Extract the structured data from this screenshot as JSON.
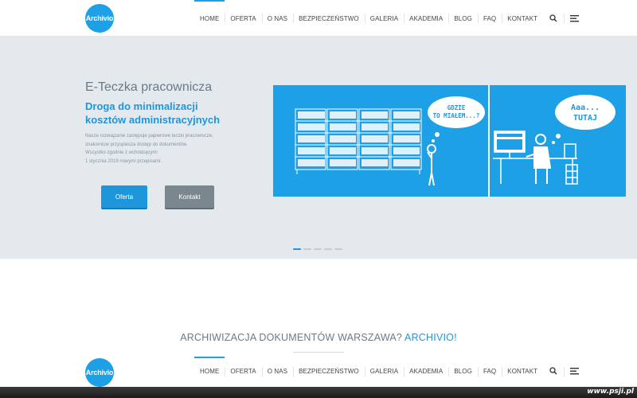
{
  "nav": {
    "logo": "Archivio",
    "items": [
      "HOME",
      "OFERTA",
      "O NAS",
      "BEZPIECZEŃSTWO",
      "GALERIA",
      "AKADEMIA",
      "BLOG",
      "FAQ",
      "KONTAKT"
    ],
    "active": "HOME",
    "icons": [
      "search-icon",
      "menu-lines-icon"
    ]
  },
  "hero": {
    "kicker": "E-Teczka pracownicza",
    "title_line1": "Droga do minimalizacji",
    "title_line2": "kosztów administracyjnych",
    "desc": [
      "Nasze rozwiązanie zastępuje papierowe teczki pracownicze,",
      "znakomicie przyspiesza dostęp do dokumentów.",
      "Wszystko zgodnie z wchodzącymi",
      "1 stycznia 2019 nowymi przepisami."
    ],
    "btn_oferta": "Oferta",
    "btn_kontakt": "Kontakt",
    "bubble_left_line1": "GDZIE",
    "bubble_left_line2": "TO MIAŁEM...?",
    "bubble_right_line1": "Aaa...",
    "bubble_right_line2": "TUTAJ",
    "slides": 5,
    "active_slide": 0
  },
  "section": {
    "title": "ARCHIWIZACJA DOKUMENTÓW WARSZAWA?",
    "accent": "ARCHIVIO!"
  },
  "watermark": "www.psji.pl",
  "colors": {
    "accent": "#1e96dc",
    "hero_bg": "#e4e9ed",
    "illus_bg": "#1ea0e6"
  }
}
